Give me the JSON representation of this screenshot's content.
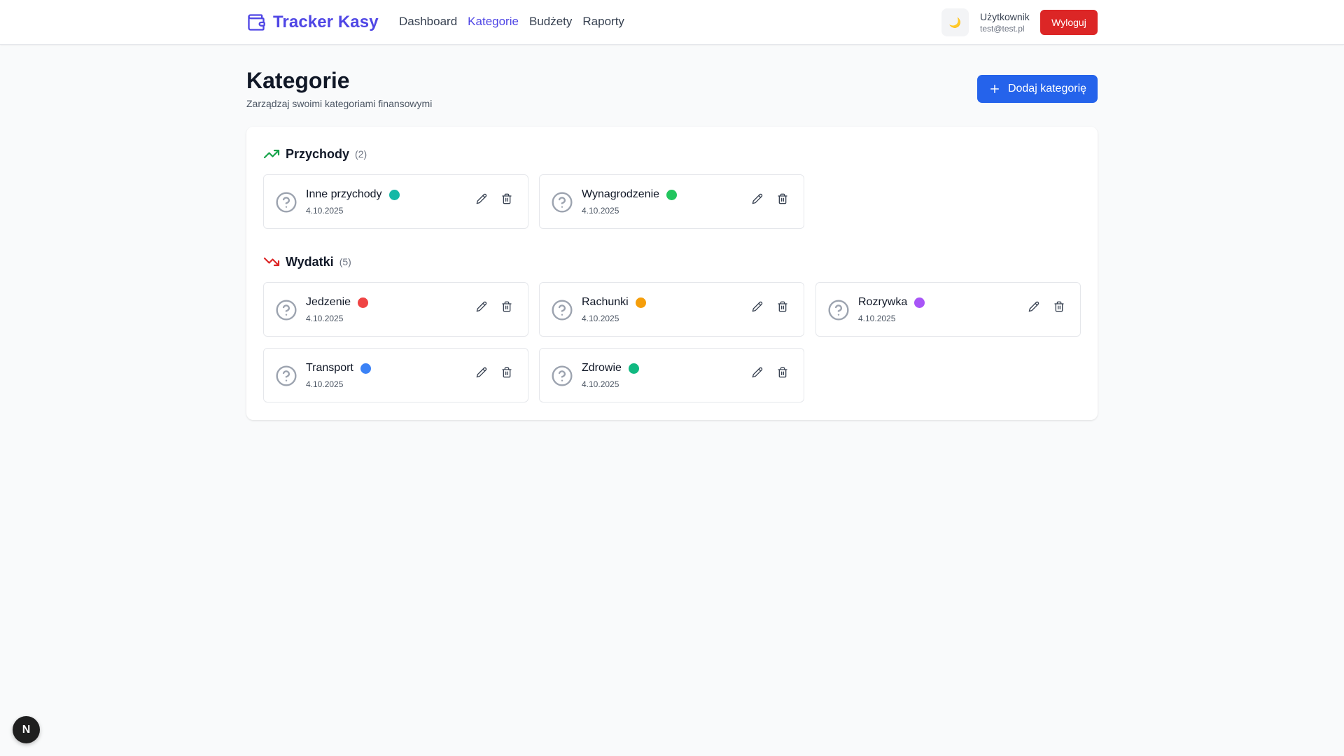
{
  "header": {
    "brand": "Tracker Kasy",
    "nav": [
      {
        "label": "Dashboard",
        "active": false
      },
      {
        "label": "Kategorie",
        "active": true
      },
      {
        "label": "Budżety",
        "active": false
      },
      {
        "label": "Raporty",
        "active": false
      }
    ],
    "theme_icon": "🌙",
    "user_name": "Użytkownik",
    "user_email": "test@test.pl",
    "logout_label": "Wyloguj"
  },
  "page": {
    "title": "Kategorie",
    "subtitle": "Zarządzaj swoimi kategoriami finansowymi",
    "add_label": "Dodaj kategorię"
  },
  "sections": {
    "income": {
      "title": "Przychody",
      "count": "(2)",
      "icon": "trending-up-icon",
      "color": "#16a34a",
      "items": [
        {
          "name": "Inne przychody",
          "date": "4.10.2025",
          "color": "#14b8a6"
        },
        {
          "name": "Wynagrodzenie",
          "date": "4.10.2025",
          "color": "#22c55e"
        }
      ]
    },
    "expense": {
      "title": "Wydatki",
      "count": "(5)",
      "icon": "trending-down-icon",
      "color": "#dc2626",
      "items": [
        {
          "name": "Jedzenie",
          "date": "4.10.2025",
          "color": "#ef4444"
        },
        {
          "name": "Rachunki",
          "date": "4.10.2025",
          "color": "#f59e0b"
        },
        {
          "name": "Rozrywka",
          "date": "4.10.2025",
          "color": "#a855f7"
        },
        {
          "name": "Transport",
          "date": "4.10.2025",
          "color": "#3b82f6"
        },
        {
          "name": "Zdrowie",
          "date": "4.10.2025",
          "color": "#10b981"
        }
      ]
    }
  },
  "dev_badge": "N",
  "colors": {
    "brand": "#4f46e5",
    "primary": "#2563eb",
    "danger": "#dc2626"
  }
}
